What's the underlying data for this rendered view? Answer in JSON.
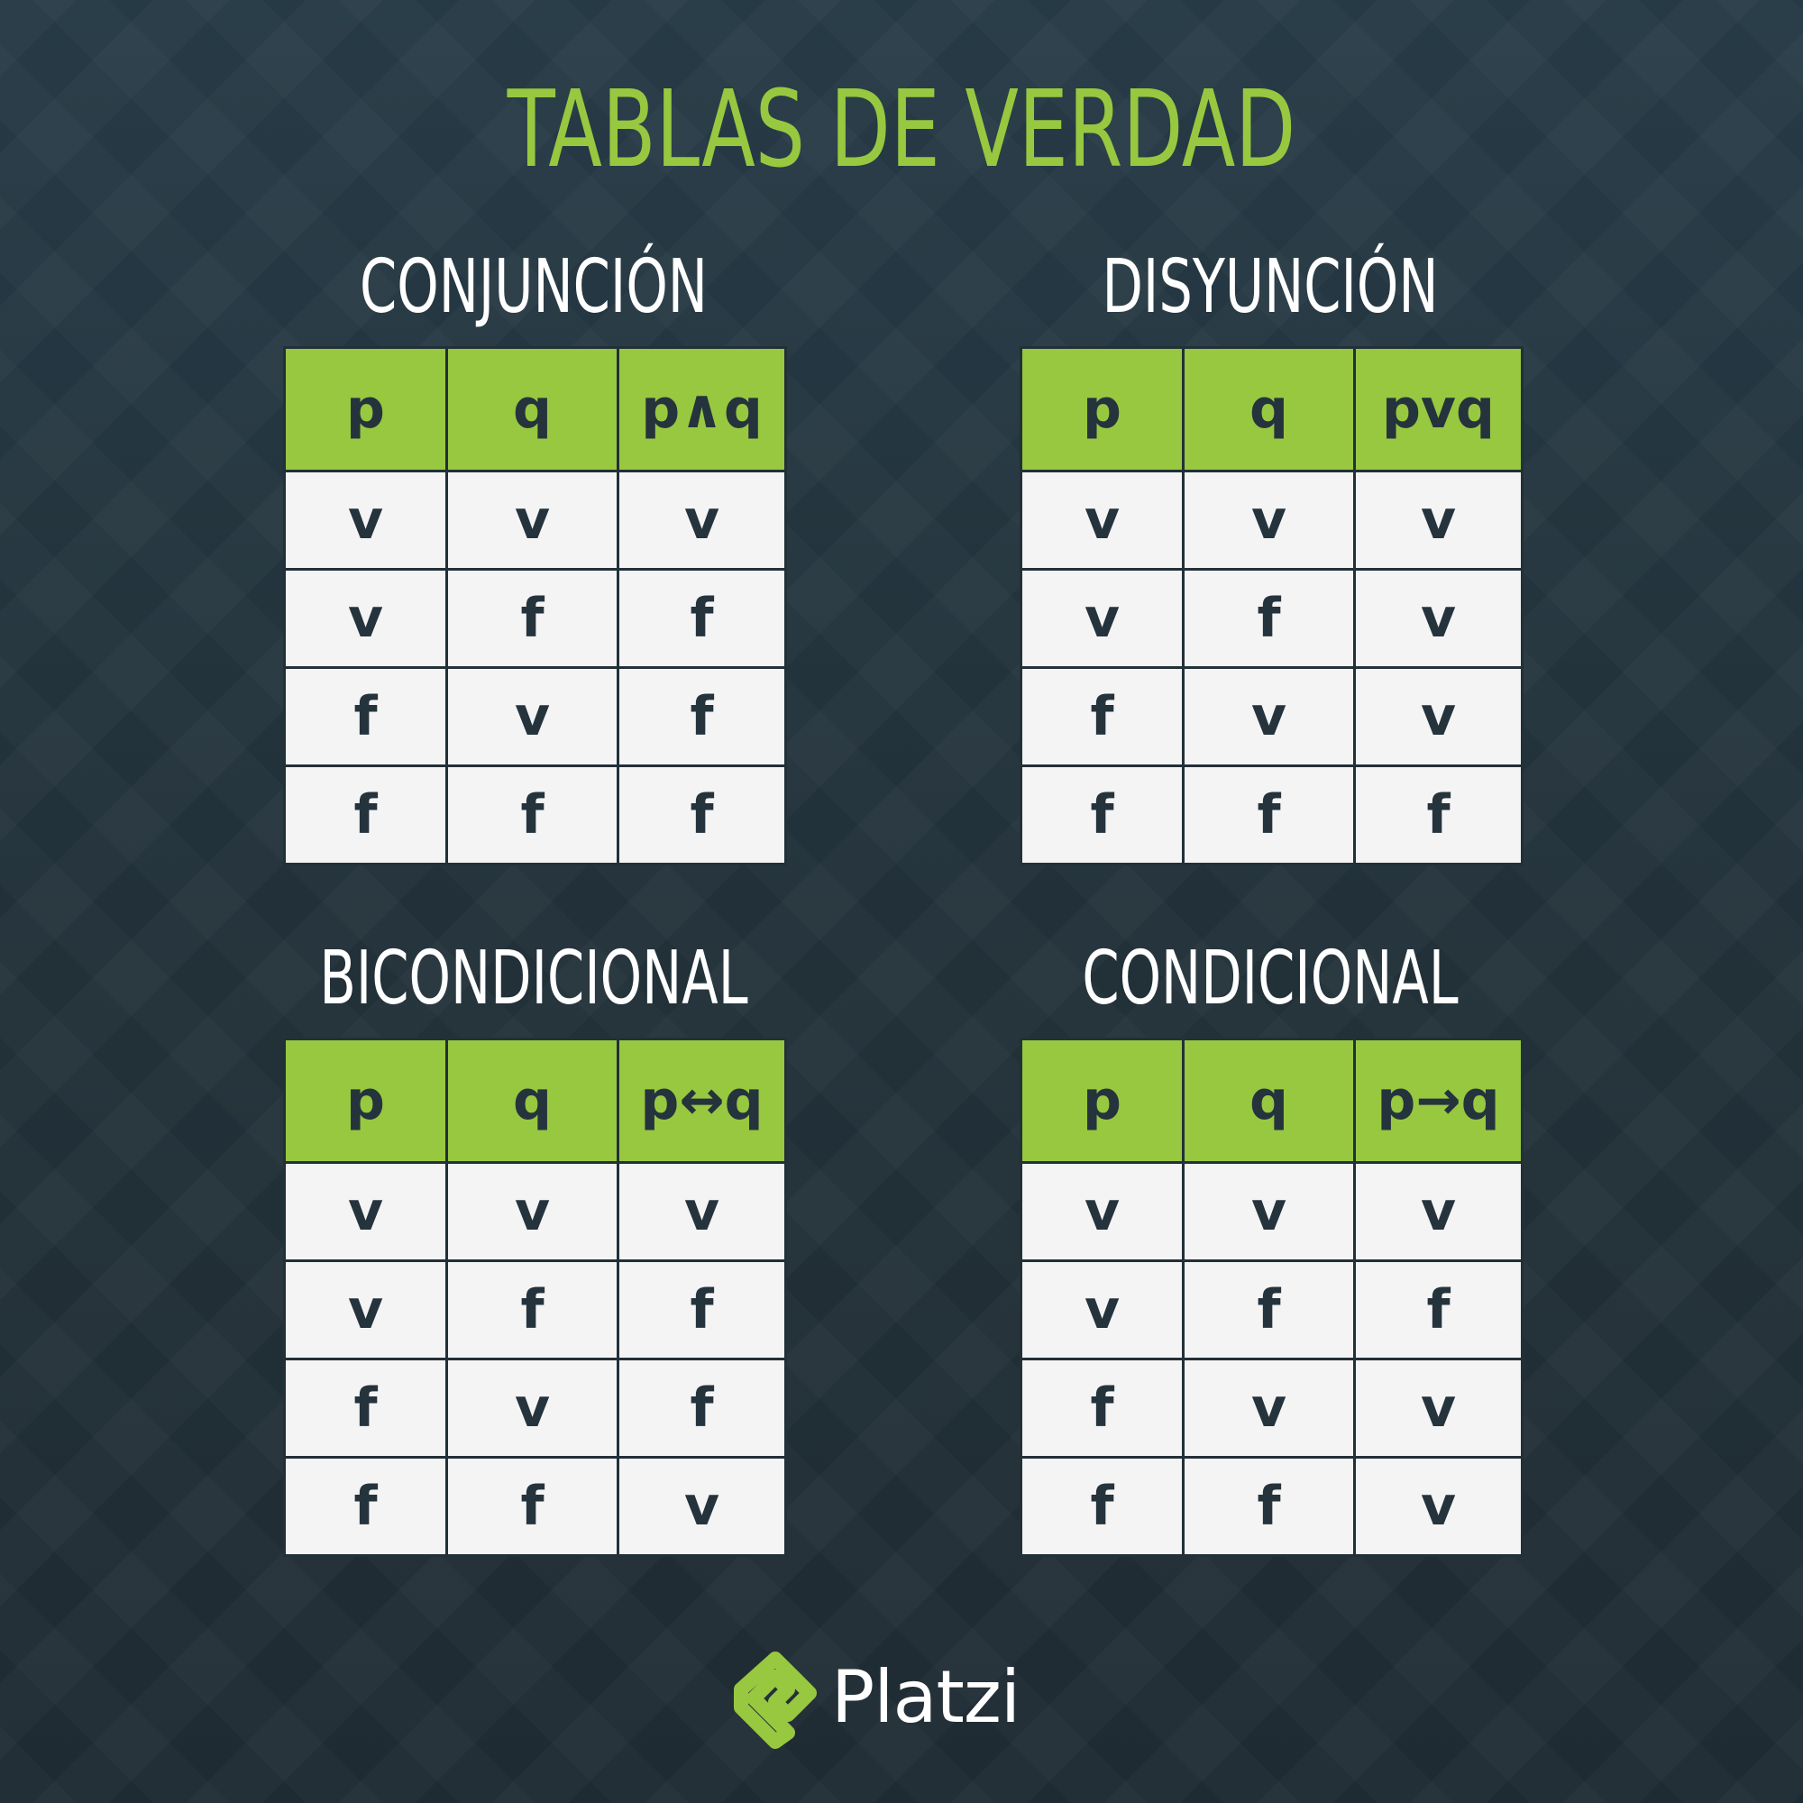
{
  "title": "TABLAS DE VERDAD",
  "tables": [
    {
      "title": "CONJUNCIÓN",
      "headers": [
        "p",
        "q",
        "p∧q"
      ],
      "rows": [
        [
          "v",
          "v",
          "v"
        ],
        [
          "v",
          "f",
          "f"
        ],
        [
          "f",
          "v",
          "f"
        ],
        [
          "f",
          "f",
          "f"
        ]
      ]
    },
    {
      "title": "DISYUNCIÓN",
      "headers": [
        "p",
        "q",
        "pvq"
      ],
      "rows": [
        [
          "v",
          "v",
          "v"
        ],
        [
          "v",
          "f",
          "v"
        ],
        [
          "f",
          "v",
          "v"
        ],
        [
          "f",
          "f",
          "f"
        ]
      ]
    },
    {
      "title": "BICONDICIONAL",
      "headers": [
        "p",
        "q",
        "p↔q"
      ],
      "rows": [
        [
          "v",
          "v",
          "v"
        ],
        [
          "v",
          "f",
          "f"
        ],
        [
          "f",
          "v",
          "f"
        ],
        [
          "f",
          "f",
          "v"
        ]
      ]
    },
    {
      "title": "CONDICIONAL",
      "headers": [
        "p",
        "q",
        "p→q"
      ],
      "rows": [
        [
          "v",
          "v",
          "v"
        ],
        [
          "v",
          "f",
          "f"
        ],
        [
          "f",
          "v",
          "v"
        ],
        [
          "f",
          "f",
          "v"
        ]
      ]
    }
  ],
  "logo": {
    "text": "Platzi",
    "icon": "platzi-logo-icon"
  },
  "colors": {
    "accent": "#97c840",
    "background": "#223038",
    "cell": "#f4f4f4",
    "text_dark": "#25333d",
    "text_light": "#ffffff"
  }
}
